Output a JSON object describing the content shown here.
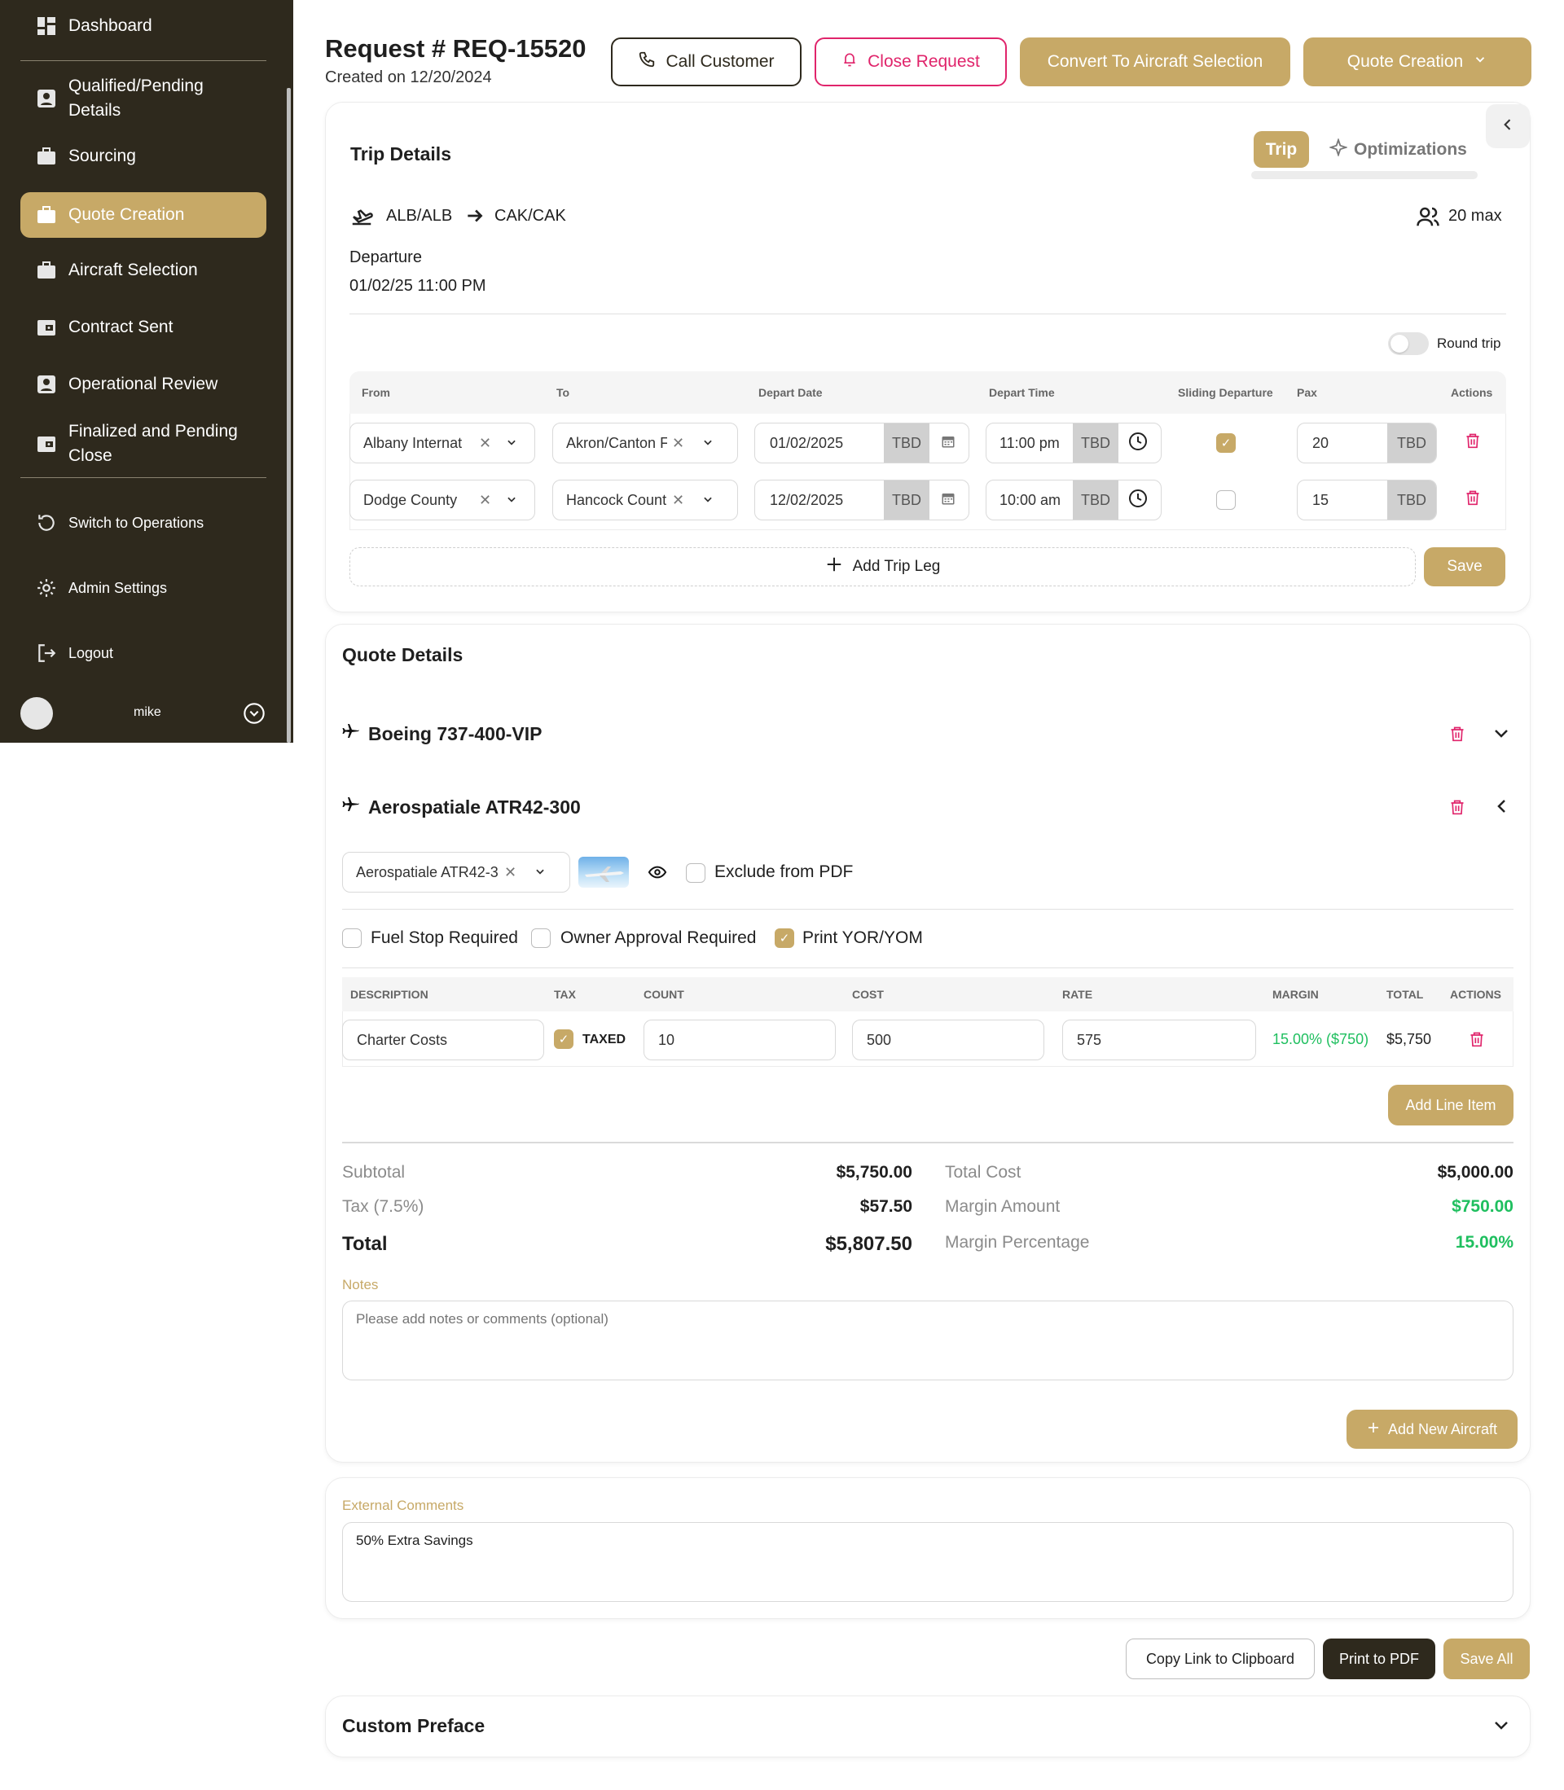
{
  "sidebar": {
    "items": [
      {
        "label": "Dashboard",
        "icon": "dashboard-icon"
      },
      {
        "label": "Qualified/Pending Details",
        "icon": "profile-icon"
      },
      {
        "label": "Sourcing",
        "icon": "briefcase-icon"
      },
      {
        "label": "Quote Creation",
        "icon": "briefcase-icon"
      },
      {
        "label": "Aircraft Selection",
        "icon": "briefcase-icon"
      },
      {
        "label": "Contract Sent",
        "icon": "wallet-icon"
      },
      {
        "label": "Operational Review",
        "icon": "profile-icon"
      },
      {
        "label": "Finalized and Pending Close",
        "icon": "wallet-icon"
      }
    ],
    "actions": [
      {
        "label": "Switch to Operations",
        "icon": "refresh-icon"
      },
      {
        "label": "Admin Settings",
        "icon": "gear-icon"
      },
      {
        "label": "Logout",
        "icon": "logout-icon"
      }
    ],
    "user": {
      "name": "mike"
    }
  },
  "header": {
    "title": "Request # REQ-15520",
    "created": "Created on 12/20/2024",
    "call_customer": "Call Customer",
    "close_request": "Close Request",
    "convert": "Convert To Aircraft Selection",
    "stage": "Quote Creation"
  },
  "trip": {
    "title": "Trip Details",
    "tab_trip": "Trip",
    "tab_opt": "Optimizations",
    "from": "ALB/ALB",
    "to": "CAK/CAK",
    "pax_max": "20 max",
    "departure_label": "Departure",
    "departure_value": "01/02/25 11:00 PM",
    "round_trip": "Round trip",
    "columns": [
      "From",
      "To",
      "Depart Date",
      "Depart Time",
      "Sliding Departure",
      "Pax",
      "Actions"
    ],
    "legs": [
      {
        "from": "Albany Internat",
        "to": "Akron/Canton F",
        "date": "01/02/2025",
        "time": "11:00 pm",
        "sliding": true,
        "pax": "20",
        "tbd": "TBD"
      },
      {
        "from": "Dodge County",
        "to": "Hancock Count",
        "date": "12/02/2025",
        "time": "10:00 am",
        "sliding": false,
        "pax": "15",
        "tbd": "TBD"
      }
    ],
    "add_leg": "Add Trip Leg",
    "save": "Save"
  },
  "quote": {
    "title": "Quote Details",
    "aircraft_1": "Boeing 737-400-VIP",
    "aircraft_2": "Aerospatiale ATR42-300",
    "aircraft_select": "Aerospatiale ATR42-3",
    "exclude_pdf": "Exclude from PDF",
    "fuel_stop": "Fuel Stop Required",
    "owner_approval": "Owner Approval Required",
    "print_yor": "Print YOR/YOM",
    "columns": [
      "DESCRIPTION",
      "TAX",
      "COUNT",
      "COST",
      "RATE",
      "MARGIN",
      "TOTAL",
      "ACTIONS"
    ],
    "line": {
      "description": "Charter Costs",
      "tax": "TAXED",
      "count": "10",
      "cost": "500",
      "rate": "575",
      "margin": "15.00% ($750)",
      "total": "$5,750"
    },
    "add_line": "Add Line Item",
    "subtotal_label": "Subtotal",
    "subtotal": "$5,750.00",
    "tax_label": "Tax (7.5%)",
    "tax": "$57.50",
    "total_label": "Total",
    "total": "$5,807.50",
    "total_cost_label": "Total Cost",
    "total_cost": "$5,000.00",
    "margin_amount_label": "Margin Amount",
    "margin_amount": "$750.00",
    "margin_pct_label": "Margin Percentage",
    "margin_pct": "15.00%",
    "notes_label": "Notes",
    "notes_placeholder": "Please add notes or comments (optional)",
    "add_aircraft": "Add New Aircraft"
  },
  "external": {
    "label": "External Comments",
    "value": "50% Extra Savings"
  },
  "footer": {
    "copy_link": "Copy Link to Clipboard",
    "print_pdf": "Print to PDF",
    "save_all": "Save All"
  },
  "preface": {
    "title": "Custom Preface"
  },
  "colors": {
    "accent": "#c7a967",
    "sidebar": "#2e291d",
    "danger": "#e0246b",
    "success": "#1fbf5f"
  }
}
